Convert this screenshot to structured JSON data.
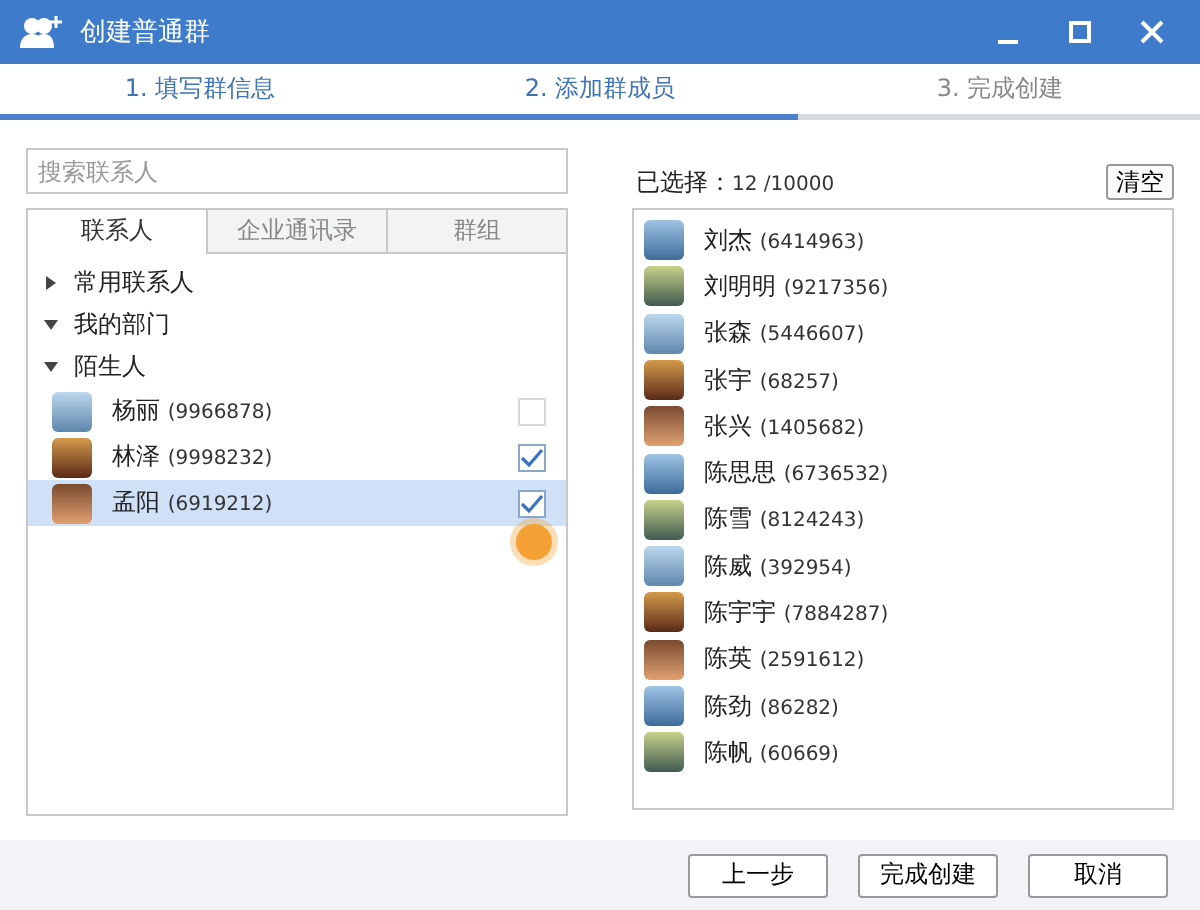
{
  "window": {
    "title": "创建普通群"
  },
  "steps": [
    {
      "label": "1. 填写群信息",
      "reached": true
    },
    {
      "label": "2. 添加群成员",
      "reached": true
    },
    {
      "label": "3. 完成创建",
      "reached": false
    }
  ],
  "progress": {
    "level": 0.665
  },
  "search": {
    "placeholder": "搜索联系人"
  },
  "tabs": [
    {
      "label": "联系人",
      "selected": true
    },
    {
      "label": "企业通讯录",
      "selected": false
    },
    {
      "label": "群组",
      "selected": false
    }
  ],
  "tree": [
    {
      "label": "常用联系人",
      "expanded": false
    },
    {
      "label": "我的部门",
      "expanded": true
    },
    {
      "label": "陌生人",
      "expanded": true,
      "children": [
        {
          "name": "杨丽",
          "id": "(9966878)",
          "checked": false,
          "selected": false
        },
        {
          "name": "林泽",
          "id": "(9998232)",
          "checked": true,
          "selected": false
        },
        {
          "name": "孟阳",
          "id": "(6919212)",
          "checked": true,
          "selected": true
        }
      ]
    }
  ],
  "selected_summary": {
    "label": "已选择：",
    "count": "12 /10000",
    "clear_button": "清空"
  },
  "members": [
    {
      "name": "刘杰",
      "id": "(6414963)"
    },
    {
      "name": "刘明明",
      "id": "(9217356)"
    },
    {
      "name": "张森",
      "id": "(5446607)"
    },
    {
      "name": "张宇",
      "id": "(68257)"
    },
    {
      "name": "张兴",
      "id": "(1405682)"
    },
    {
      "name": "陈思思",
      "id": "(6736532)"
    },
    {
      "name": "陈雪",
      "id": "(8124243)"
    },
    {
      "name": "陈威",
      "id": "(392954)"
    },
    {
      "name": "陈宇宇",
      "id": "(7884287)"
    },
    {
      "name": "陈英",
      "id": "(2591612)"
    },
    {
      "name": "陈劲",
      "id": "(86282)"
    },
    {
      "name": "陈帆",
      "id": "(60669)"
    }
  ],
  "buttons": [
    "上一步",
    "完成创建",
    "取消"
  ]
}
